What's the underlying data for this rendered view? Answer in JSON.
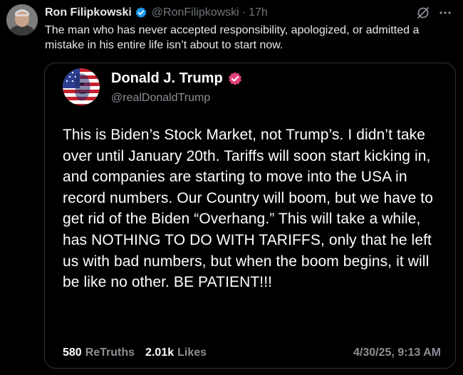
{
  "post": {
    "author_name": "Ron Filipkowski",
    "handle": "@RonFilipkowski",
    "separator": "·",
    "time": "17h",
    "text": "The man who has never accepted responsibility, apologized, or admitted a mistake in his entire life isn’t about to start now.",
    "icons": {
      "avatar": "avatar-photo",
      "verified": "verified-badge-icon",
      "grok": "grok-icon",
      "more": "more-icon"
    }
  },
  "quoted_post": {
    "author_name": "Donald J. Trump",
    "handle": "@realDonaldTrump",
    "text": "This is Biden’s Stock Market, not Trump’s. I didn’t take over until January 20th. Tariffs will soon start kicking in, and companies are starting to move into the USA in record numbers. Our Country will boom, but we have to get rid of the Biden “Overhang.” This will take a while, has NOTHING TO DO WITH TARIFFS, only that he left us with bad numbers, but when the boom begins, it will be like no other. BE PATIENT!!!",
    "retruths_count": "580",
    "retruths_label": "ReTruths",
    "likes_count": "2.01k",
    "likes_label": "Likes",
    "date": "4/30/25, 9:13 AM",
    "icons": {
      "avatar": "flag-face-avatar",
      "verified": "verified-badge-icon"
    }
  },
  "colors": {
    "background": "#000000",
    "text_primary": "#e7e9ea",
    "text_secondary": "#71767b",
    "x_verified": "#1d9bf0",
    "truth_verified": "#e0417b",
    "card_border": "#2f3336"
  }
}
